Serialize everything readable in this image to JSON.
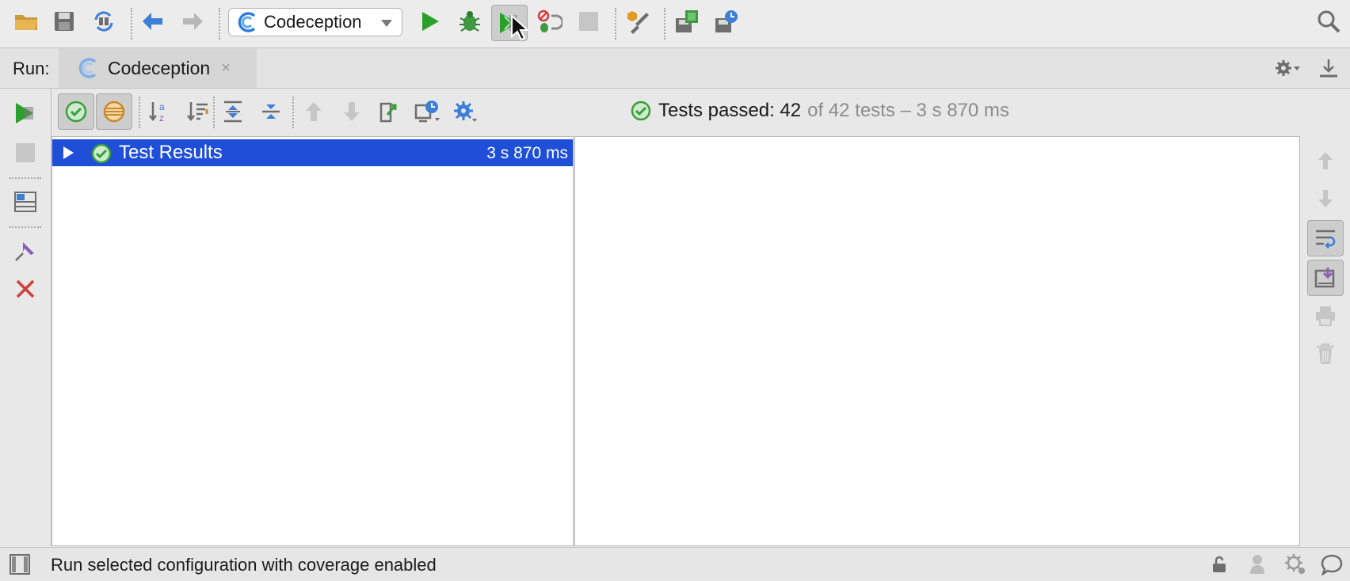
{
  "toolbar": {
    "run_config": {
      "label": "Codeception",
      "icon": "codeception-icon"
    },
    "icons": [
      "open-folder-icon",
      "save-icon",
      "sync-icon",
      "back-icon",
      "forward-icon",
      "run-icon",
      "debug-icon",
      "run-with-coverage-icon",
      "profile-icon",
      "stop-icon",
      "settings-wrench-icon",
      "sdk-icon",
      "save-config-icon",
      "search-icon"
    ]
  },
  "run_header": {
    "label": "Run:",
    "tab": {
      "name": "Codeception",
      "close": "×"
    }
  },
  "test_toolbar": {
    "status": {
      "prefix": "Tests passed: 42",
      "suffix": "of 42 tests – 3 s 870 ms"
    }
  },
  "tree": {
    "rows": [
      {
        "title": "Test Results",
        "time": "3 s 870 ms",
        "selected": true
      }
    ]
  },
  "status_bar": {
    "message": "Run selected configuration with coverage enabled"
  },
  "colors": {
    "selection": "#1f4fd9",
    "run_green": "#2aa02a",
    "pass_green": "#3a9f3a",
    "accent_blue": "#3d7fd6",
    "close_red": "#d03e3e"
  }
}
